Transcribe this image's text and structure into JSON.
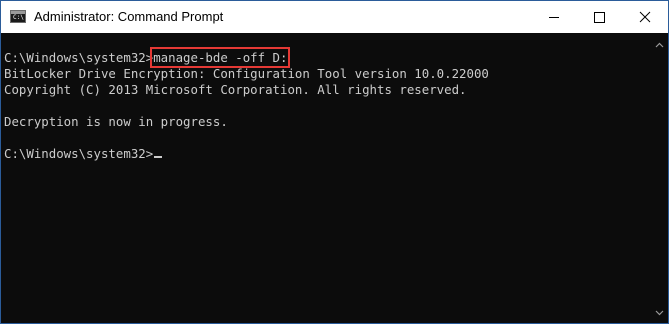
{
  "window": {
    "title": "Administrator: Command Prompt",
    "icon": "cmd-icon",
    "icon_text": "C:\\",
    "controls": [
      "minimize-icon",
      "maximize-icon",
      "close-icon"
    ]
  },
  "console": {
    "prompt": "C:\\Windows\\system32>",
    "command": "manage-bde -off D:",
    "output": [
      "BitLocker Drive Encryption: Configuration Tool version 10.0.22000",
      "Copyright (C) 2013 Microsoft Corporation. All rights reserved.",
      "",
      "Decryption is now in progress."
    ],
    "final_prompt": "C:\\Windows\\system32>"
  },
  "colors": {
    "console_bg": "#0c0c0c",
    "console_text": "#cccccc",
    "highlight_border": "#e53935"
  }
}
